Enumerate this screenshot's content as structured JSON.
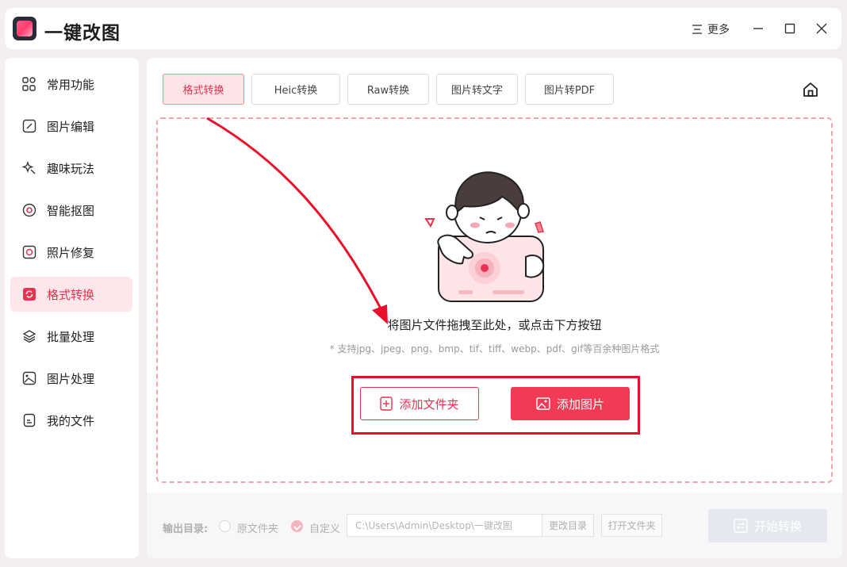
{
  "app": {
    "title": "一键改图",
    "more_label": "更多"
  },
  "sidebar": {
    "items": [
      {
        "label": "常用功能",
        "icon": "grid-icon"
      },
      {
        "label": "图片编辑",
        "icon": "edit-icon"
      },
      {
        "label": "趣味玩法",
        "icon": "magic-icon"
      },
      {
        "label": "智能抠图",
        "icon": "target-icon"
      },
      {
        "label": "照片修复",
        "icon": "repair-icon"
      },
      {
        "label": "格式转换",
        "icon": "convert-icon",
        "active": true
      },
      {
        "label": "批量处理",
        "icon": "layers-icon"
      },
      {
        "label": "图片处理",
        "icon": "image-icon"
      },
      {
        "label": "我的文件",
        "icon": "file-icon"
      }
    ]
  },
  "tabs": [
    {
      "label": "格式转换",
      "active": true
    },
    {
      "label": "Heic转换"
    },
    {
      "label": "Raw转换"
    },
    {
      "label": "图片转文字"
    },
    {
      "label": "图片转PDF"
    }
  ],
  "dropzone": {
    "text": "将图片文件拖拽至此处，或点击下方按钮",
    "hint": "* 支持jpg、jpeg、png、bmp、tif、tiff、webp、pdf、gif等百余种图片格式",
    "add_folder_label": "添加文件夹",
    "add_image_label": "添加图片"
  },
  "footer": {
    "output_label": "输出目录:",
    "option_original": "原文件夹",
    "option_custom": "自定义",
    "selected_option": "自定义",
    "path_value": "C:\\Users\\Admin\\Desktop\\一键改图",
    "change_dir_label": "更改目录",
    "open_folder_label": "打开文件夹",
    "start_label": "开始转换"
  },
  "colors": {
    "accent": "#f23a55",
    "accent_light": "#fde4e6",
    "annotation_red": "#e8102a",
    "disabled": "#e6e8ef"
  }
}
